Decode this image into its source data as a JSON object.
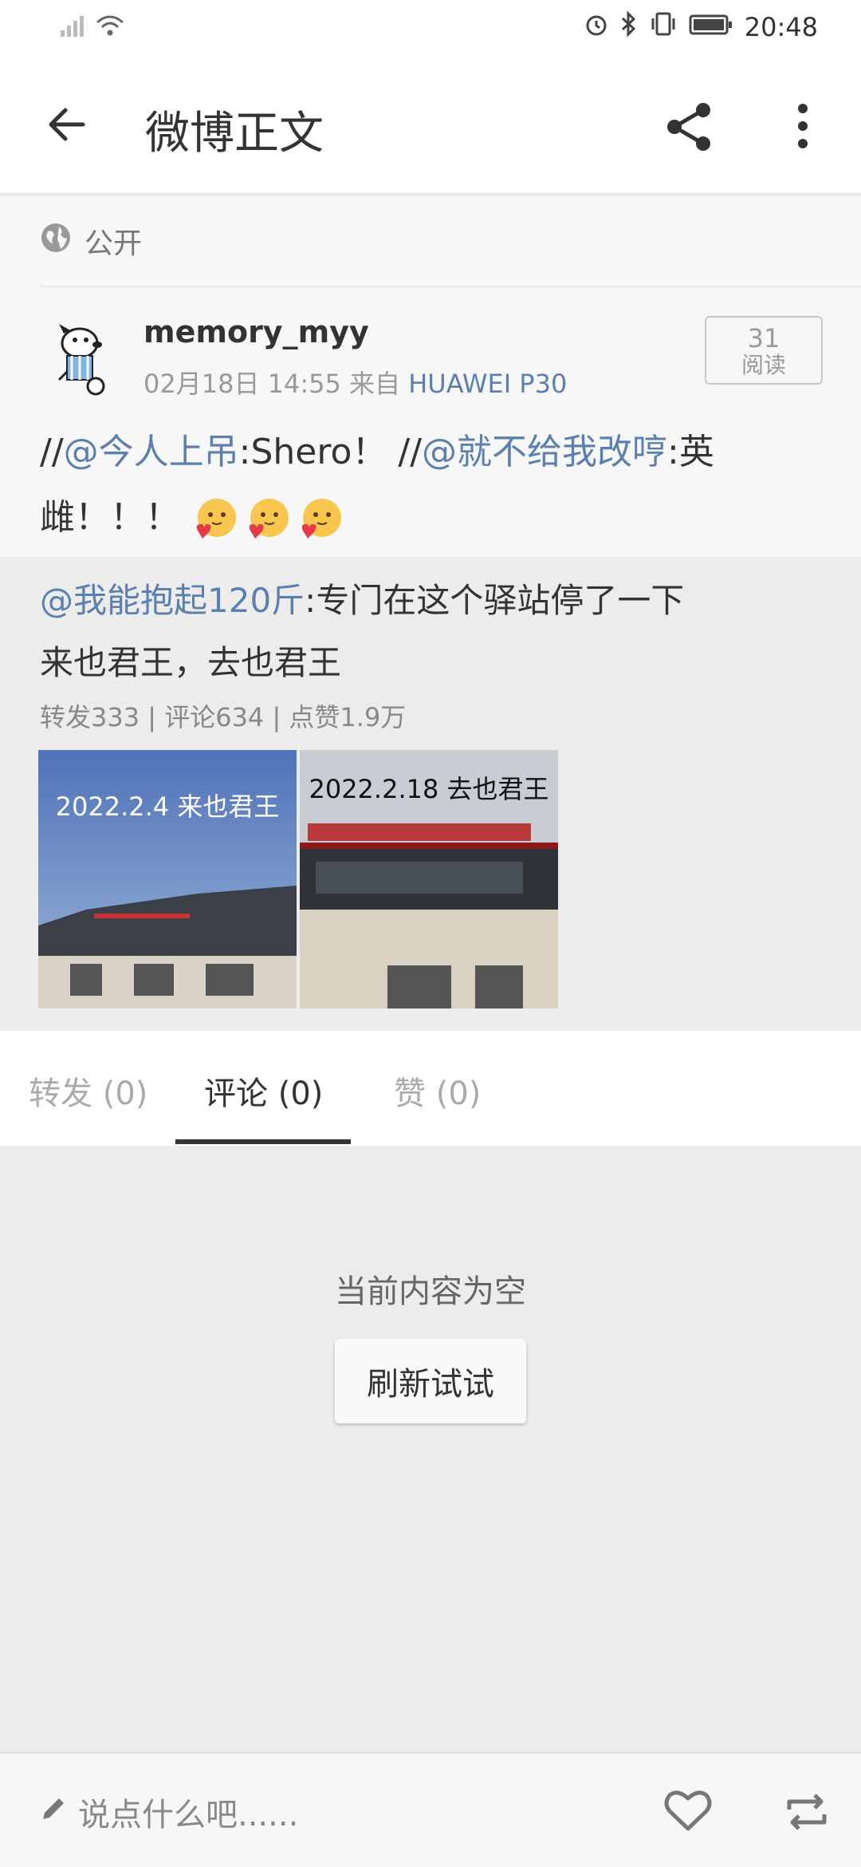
{
  "status_bar": {
    "time": "20:48"
  },
  "app_bar": {
    "title": "微博正文"
  },
  "post": {
    "visibility": "公开",
    "author": "memory_myy",
    "date": "02月18日 14:55",
    "source_prefix": "来自",
    "device": "HUAWEI P30",
    "read_count": "31",
    "read_label": "阅读",
    "text": {
      "prefix1": "//",
      "mention1": "@今人上吊",
      "part1": ":Shero！ //",
      "mention2": "@就不给我改哼",
      "part2": ":英雌！！！"
    },
    "emoji": [
      "hugging-emoji",
      "hugging-emoji",
      "hugging-emoji"
    ]
  },
  "repost": {
    "mention": "@我能抱起120斤",
    "line1": ":专门在这个驿站停了一下",
    "line2": "来也君王，去也君王",
    "stats": "转发333 | 评论634 | 点赞1.9万",
    "photos": [
      {
        "caption": "2022.2.4  来也君王"
      },
      {
        "caption": "2022.2.18 去也君王"
      }
    ]
  },
  "tabs": [
    {
      "label": "转发 (0)",
      "active": false
    },
    {
      "label": "评论 (0)",
      "active": true
    },
    {
      "label": "赞 (0)",
      "active": false
    }
  ],
  "empty_state": {
    "message": "当前内容为空",
    "refresh_label": "刷新试试"
  },
  "bottom_bar": {
    "placeholder": "说点什么吧......"
  },
  "colors": {
    "link": "#5b7fae",
    "text": "#333333",
    "muted": "#999999"
  }
}
